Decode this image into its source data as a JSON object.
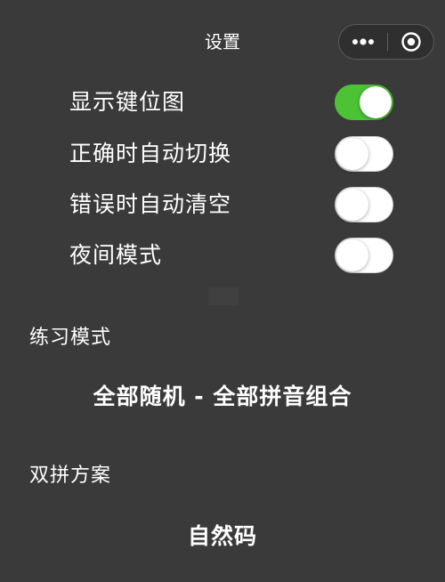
{
  "header": {
    "title": "设置",
    "more_icon": "more-dots-icon",
    "close_icon": "record-circle-icon"
  },
  "settings": [
    {
      "label": "显示键位图",
      "enabled": true
    },
    {
      "label": "正确时自动切换",
      "enabled": false
    },
    {
      "label": "错误时自动清空",
      "enabled": false
    },
    {
      "label": "夜间模式",
      "enabled": false
    }
  ],
  "practice_mode": {
    "title": "练习模式",
    "value": "全部随机 - 全部拼音组合"
  },
  "shuangpin_scheme": {
    "title": "双拼方案",
    "value": "自然码"
  },
  "colors": {
    "background": "#3a3a3a",
    "switch_on": "#4cc335",
    "switch_off": "#ffffff",
    "text": "#ffffff"
  }
}
